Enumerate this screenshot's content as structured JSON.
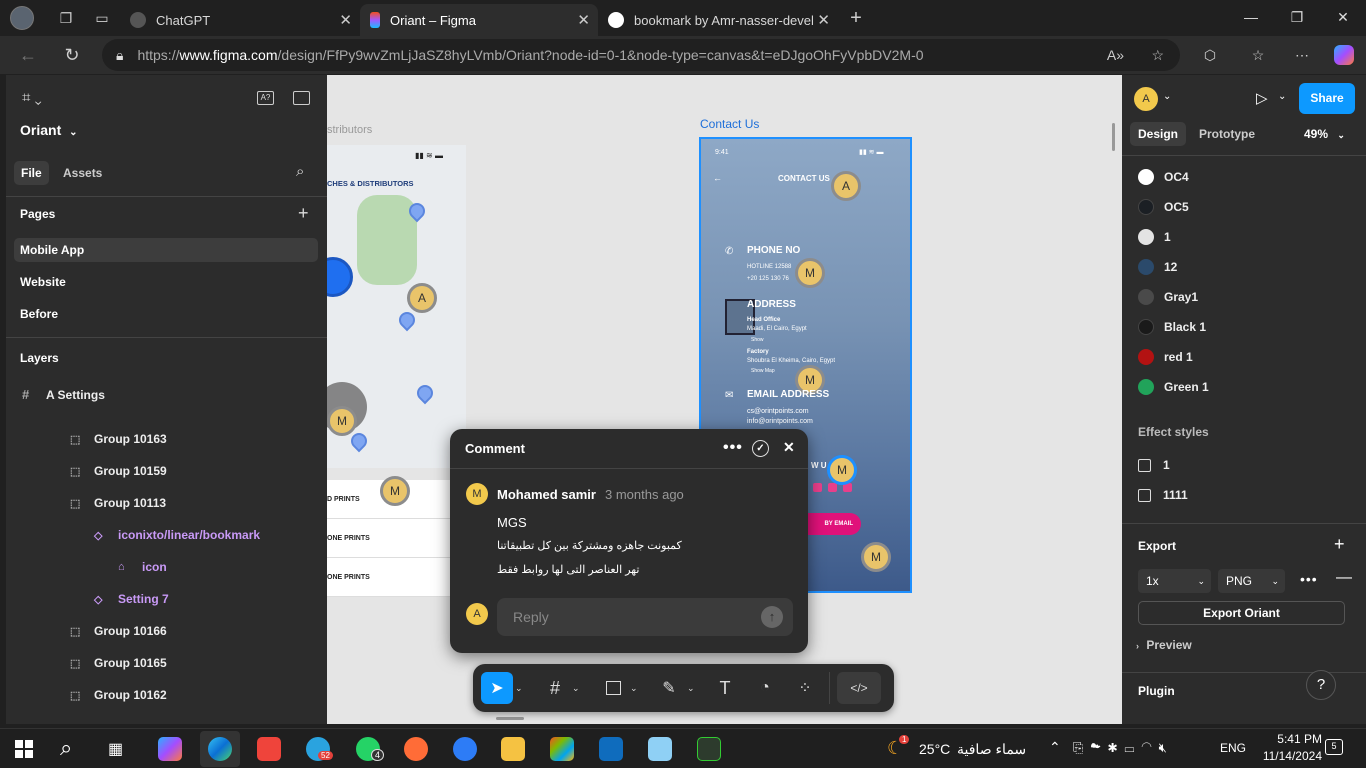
{
  "browser": {
    "tabs": [
      {
        "title": "ChatGPT"
      },
      {
        "title": "Oriant – Figma"
      },
      {
        "title": "bookmark by Amr-nasser-develop"
      }
    ],
    "url_prefix": "https://",
    "url_domain": "www.figma.com",
    "url_rest": "/design/FfPy9wvZmLjJaSZ8hyLVmb/Oriant?node-id=0-1&node-type=canvas&t=eDJgoOhFyVpbDV2M-0"
  },
  "left": {
    "file_name": "Oriant",
    "tab_file": "File",
    "tab_assets": "Assets",
    "pages_title": "Pages",
    "pages": [
      "Mobile App",
      "Website",
      "Before"
    ],
    "layers_title": "Layers",
    "layers": [
      {
        "name": "A Settings",
        "icon": "frame-icon"
      },
      {
        "name": "Group 10163",
        "icon": "group-icon"
      },
      {
        "name": "Group 10159",
        "icon": "group-icon"
      },
      {
        "name": "Group 10113",
        "icon": "group-icon"
      },
      {
        "name": "iconixto/linear/bookmark",
        "icon": "component-icon"
      },
      {
        "name": "icon",
        "icon": "bookmark-icon"
      },
      {
        "name": "Setting 7",
        "icon": "component-icon"
      },
      {
        "name": "Group 10166",
        "icon": "group-icon"
      },
      {
        "name": "Group 10165",
        "icon": "group-icon"
      },
      {
        "name": "Group 10162",
        "icon": "group-icon"
      }
    ]
  },
  "canvas": {
    "frame1_label": "stributors",
    "map_heading": "CHES & DISTRIBUTORS",
    "list_rows": [
      "D PRINTS",
      "ONE PRINTS",
      "ONE PRINTS"
    ],
    "frame2_label": "Contact Us",
    "phone": {
      "time": "9:41",
      "title": "CONTACT US",
      "phone_heading": "PHONE NO",
      "hotline": "HOTLINE 12588",
      "phone_number": "+20 125 130 76",
      "address_heading": "ADDRESS",
      "head_office": "Head Office",
      "head_office_addr": "Maadi, El Cairo, Egypt",
      "show": "Show",
      "factory": "Factory",
      "factory_addr": "Shoubra El Kheima, Cairo, Egypt",
      "show_map": "Show Map",
      "email_heading": "EMAIL ADDRESS",
      "email1": "cs@orintpoints.com",
      "email2": "info@orintpoints.com",
      "follow": "W U",
      "by_email": "BY EMAIL"
    },
    "avatars": {
      "a": "A",
      "m": "M"
    }
  },
  "comment": {
    "title": "Comment",
    "author_initial": "M",
    "author": "Mohamed samir",
    "time": "3 months ago",
    "line1": "MGS",
    "line2": "كمبونت جاهزه ومشتركة بين كل تطبيقاتنا",
    "line3": "تهر العناصر التى لها روابط فقط",
    "reply_initial": "A",
    "reply_placeholder": "Reply"
  },
  "right": {
    "user_initial": "A",
    "share": "Share",
    "tab_design": "Design",
    "tab_prototype": "Prototype",
    "zoom": "49%",
    "color_styles": [
      {
        "name": "OC4",
        "color": "#ffffff"
      },
      {
        "name": "OC5",
        "color": "#1b1f24"
      },
      {
        "name": "1",
        "color": "#e3e3e3"
      },
      {
        "name": "12",
        "color": "#2b4a6b"
      },
      {
        "name": "Gray1",
        "color": "#4a4a4a"
      },
      {
        "name": "Black 1",
        "color": "#1a1a1a"
      },
      {
        "name": "red 1",
        "color": "#b31212"
      },
      {
        "name": "Green 1",
        "color": "#21a35a"
      }
    ],
    "effect_title": "Effect styles",
    "effects": [
      "1",
      "1111"
    ],
    "export_title": "Export",
    "export_scale": "1x",
    "export_format": "PNG",
    "export_button": "Export Oriant",
    "preview": "Preview",
    "plugin_title": "Plugin",
    "help": "?"
  },
  "taskbar": {
    "telegram_badge": "52",
    "whatsapp_badge": "4",
    "weather_badge": "1",
    "temperature": "25°C",
    "weather_text": "سماء صافية",
    "lang": "ENG",
    "time": "5:41 PM",
    "date": "11/14/2024",
    "notif_count": "5"
  }
}
